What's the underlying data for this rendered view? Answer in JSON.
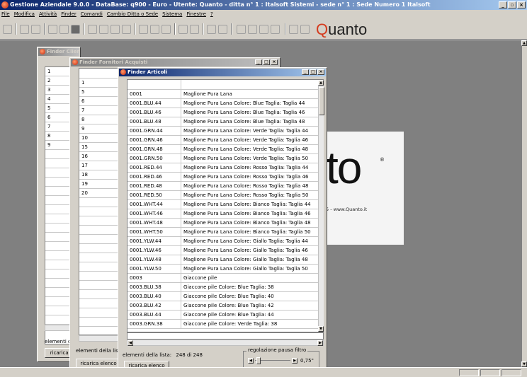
{
  "app": {
    "title": "Gestione Aziendale 9.0.0 - DataBase: q900 - Euro - Utente: Quanto - ditta n° 1 : Italsoft Sistemi - sede n° 1 : Sede Numero 1 Italsoft",
    "minimize": "_",
    "restore": "▫",
    "close": "×"
  },
  "menu": [
    "File",
    "Modifica",
    "Attività",
    "Finder",
    "Comandi",
    "Cambio Ditta o Sede",
    "Sistema",
    "Finestre",
    "?"
  ],
  "toolbar": {
    "brand_first": "Q",
    "brand_rest": "uanto"
  },
  "logo": {
    "big": "to",
    "reg": "®",
    "url": "5 - www.Quanto.it"
  },
  "clienti": {
    "title": "Finder Clienti Vendita",
    "rows": [
      "1",
      "2",
      "3",
      "4",
      "5",
      "6",
      "7",
      "8",
      "9"
    ],
    "count_label": "elementi di",
    "reload": "ricarica e"
  },
  "fornitori": {
    "title": "Finder Fornitori Acquisti",
    "rows": [
      "1",
      "5",
      "6",
      "7",
      "8",
      "9",
      "10",
      "15",
      "16",
      "17",
      "18",
      "19",
      "20"
    ],
    "count_label": "elementi della list",
    "reload": "ricarica elenco"
  },
  "articoli": {
    "title": "Finder Articoli",
    "rows": [
      [
        "0001",
        "Maglione Pura Lana"
      ],
      [
        "0001.BLU.44",
        "Maglione Pura Lana Colore: Blue Taglia: Taglia 44"
      ],
      [
        "0001.BLU.46",
        "Maglione Pura Lana Colore: Blue Taglia: Taglia 46"
      ],
      [
        "0001.BLU.48",
        "Maglione Pura Lana Colore: Blue Taglia: Taglia 48"
      ],
      [
        "0001.GRN.44",
        "Maglione Pura Lana Colore: Verde Taglia: Taglia 44"
      ],
      [
        "0001.GRN.46",
        "Maglione Pura Lana Colore: Verde Taglia: Taglia 46"
      ],
      [
        "0001.GRN.48",
        "Maglione Pura Lana Colore: Verde Taglia: Taglia 48"
      ],
      [
        "0001.GRN.50",
        "Maglione Pura Lana Colore: Verde Taglia: Taglia 50"
      ],
      [
        "0001.RED.44",
        "Maglione Pura Lana Colore: Rosso Taglia: Taglia 44"
      ],
      [
        "0001.RED.46",
        "Maglione Pura Lana Colore: Rosso Taglia: Taglia 46"
      ],
      [
        "0001.RED.48",
        "Maglione Pura Lana Colore: Rosso Taglia: Taglia 48"
      ],
      [
        "0001.RED.50",
        "Maglione Pura Lana Colore: Rosso Taglia: Taglia 50"
      ],
      [
        "0001.WHT.44",
        "Maglione Pura Lana Colore: Bianco Taglia: Taglia 44"
      ],
      [
        "0001.WHT.46",
        "Maglione Pura Lana Colore: Bianco Taglia: Taglia 46"
      ],
      [
        "0001.WHT.48",
        "Maglione Pura Lana Colore: Bianco Taglia: Taglia 48"
      ],
      [
        "0001.WHT.50",
        "Maglione Pura Lana Colore: Bianco Taglia: Taglia 50"
      ],
      [
        "0001.YLW.44",
        "Maglione Pura Lana Colore: Giallo Taglia: Taglia 44"
      ],
      [
        "0001.YLW.46",
        "Maglione Pura Lana Colore: Giallo Taglia: Taglia 46"
      ],
      [
        "0001.YLW.48",
        "Maglione Pura Lana Colore: Giallo Taglia: Taglia 48"
      ],
      [
        "0001.YLW.50",
        "Maglione Pura Lana Colore: Giallo Taglia: Taglia 50"
      ],
      [
        "0003",
        "Giaccone pile"
      ],
      [
        "0003.BLU.38",
        "Giaccone pile Colore: Blue Taglia:  38"
      ],
      [
        "0003.BLU.40",
        "Giaccone pile Colore: Blue Taglia:  40"
      ],
      [
        "0003.BLU.42",
        "Giaccone pile Colore: Blue Taglia:  42"
      ],
      [
        "0003.BLU.44",
        "Giaccone pile Colore: Blue Taglia:  44"
      ],
      [
        "0003.GRN.38",
        "Giaccone pile Colore: Verde Taglia:  38"
      ]
    ],
    "count_label": "elementi della lista:",
    "count_value": "248 di 248",
    "reload": "ricarica elenco",
    "filter_label": "regolazione pausa filtro",
    "filter_value": "0,75\""
  },
  "colors": {
    "title_active": "#0a246a",
    "title_inactive": "#808080",
    "brand_accent": "#d43b1e"
  }
}
